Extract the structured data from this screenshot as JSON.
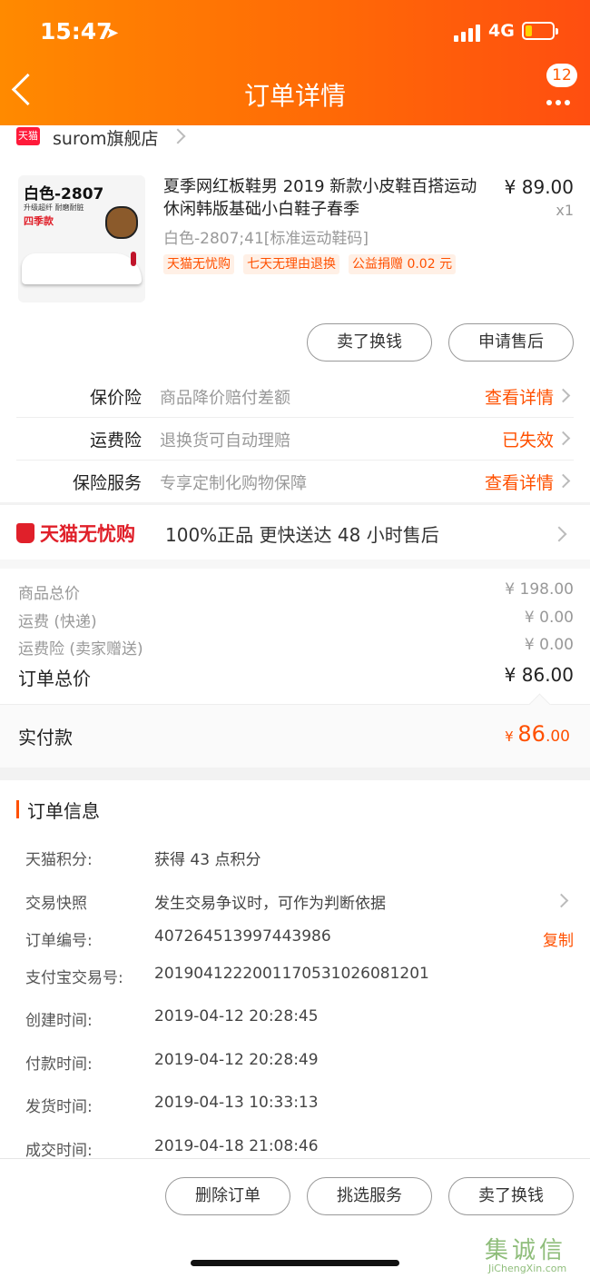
{
  "status_bar": {
    "time": "15:47",
    "location_glyph": "➤",
    "network": "4G",
    "battery_color": "#ffd200"
  },
  "header": {
    "title": "订单详情",
    "badge_count": "12",
    "accent": "#ff6a06"
  },
  "store": {
    "tag": "天猫",
    "name": "surom旗舰店"
  },
  "product": {
    "image_text": {
      "model": "白色-2807",
      "tagline": "升级超纤  耐磨耐脏",
      "season": "四季款"
    },
    "title": "夏季网红板鞋男 2019 新款小皮鞋百搭运动休闲韩版基础小白鞋子春季",
    "price": "¥ 89.00",
    "qty": "x1",
    "sku": "白色-2807;41[标准运动鞋码]",
    "tags": [
      "天猫无忧购",
      "七天无理由退换",
      "公益捐赠 0.02 元"
    ]
  },
  "item_actions": {
    "sell_label": "卖了换钱",
    "after_sale_label": "申请售后"
  },
  "insurance": [
    {
      "label": "保价险",
      "desc": "商品降价赔付差额",
      "link": "查看详情"
    },
    {
      "label": "运费险",
      "desc": "退换货可自动理赔",
      "link": "已失效"
    },
    {
      "label": "保险服务",
      "desc": "专享定制化购物保障",
      "link": "查看详情"
    }
  ],
  "worry_free": {
    "brand": "天猫无忧购",
    "text": "100%正品  更快送达  48 小时售后"
  },
  "costs": {
    "goods_label": "商品总价",
    "goods_value": "¥ 198.00",
    "shipping_label": "运费 (快递)",
    "shipping_value": "¥ 0.00",
    "freight_ins_label": "运费险 (卖家赠送)",
    "freight_ins_value": "¥ 0.00",
    "total_label": "订单总价",
    "total_value": "¥ 86.00"
  },
  "paid": {
    "label": "实付款",
    "symbol": "¥ ",
    "integer": "86",
    "decimal": ".00"
  },
  "order_info": {
    "heading": "订单信息",
    "rows": [
      {
        "key": "天猫积分:",
        "value": "获得 43 点积分"
      },
      {
        "key": "交易快照",
        "value": "发生交易争议时，可作为判断依据"
      },
      {
        "key": "订单编号:",
        "value": "407264513997443986",
        "action": "复制"
      },
      {
        "key": "支付宝交易号:",
        "value": "2019041222001170531026081201"
      },
      {
        "key": "创建时间:",
        "value": "2019-04-12 20:28:45"
      },
      {
        "key": "付款时间:",
        "value": "2019-04-12 20:28:49"
      },
      {
        "key": "发货时间:",
        "value": "2019-04-13 10:33:13"
      },
      {
        "key": "成交时间:",
        "value": "2019-04-18 21:08:46"
      }
    ]
  },
  "bottom_actions": {
    "delete_label": "删除订单",
    "pick_service_label": "挑选服务",
    "sell_label": "卖了换钱"
  },
  "watermark": {
    "text": "集诚信",
    "url_text": "JiChengXin.com"
  }
}
